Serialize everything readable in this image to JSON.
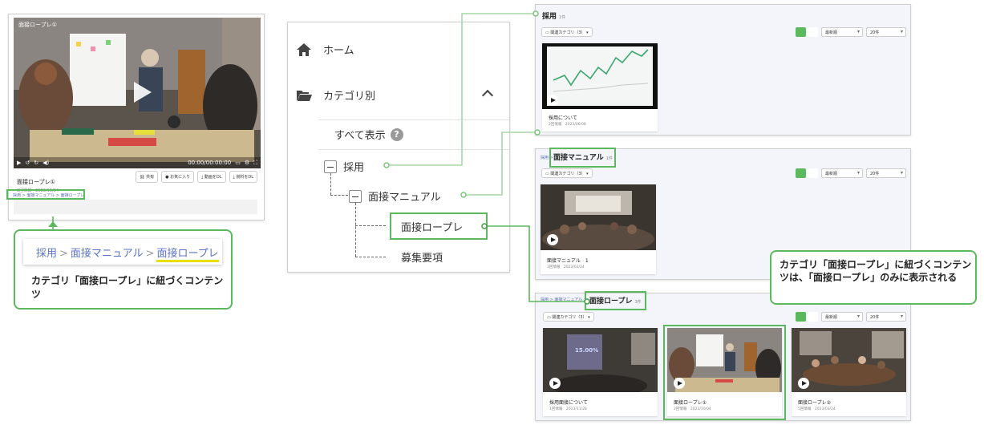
{
  "player": {
    "video_title": "面接ロープレ①",
    "time": "00:00/00:00:00",
    "title": "面接ロープレ①",
    "meta": "2回情報　2023/10/04",
    "buttons": [
      "共有",
      "お気に入り",
      "動画をDL",
      "資料をDL"
    ],
    "breadcrumb": "採用 > 面接マニュアル > 面接ロープレ"
  },
  "callout_left": {
    "crumb": [
      "採用",
      "面接マニュアル",
      "面接ロープレ"
    ],
    "separator": ">",
    "text": "カテゴリ「面接ロープレ」に紐づくコンテンツ"
  },
  "sidebar": {
    "home": "ホーム",
    "by_category": "カテゴリ別",
    "show_all": "すべて表示",
    "help": "?",
    "tree": {
      "level1": "採用",
      "level2": "面接マニュアル",
      "level3a": "面接ロープレ",
      "level3b": "募集要項"
    }
  },
  "panels": {
    "filter_label": "関連カテゴリ（3）",
    "sort": "最新順",
    "per_page": "20件",
    "saiyo": {
      "title": "採用",
      "count": "1件",
      "cards": [
        {
          "title": "採用について",
          "meta": "2回情報　2023/06/08"
        }
      ]
    },
    "mensetsu": {
      "crumb": "採用 >",
      "title": "面接マニュアル",
      "count": "1件",
      "cards": [
        {
          "title": "面接マニュアル　1",
          "meta": "3回情報　2023/03/24"
        }
      ]
    },
    "roleplay": {
      "crumb": "採用 > 面接マニュアル >",
      "title": "面接ロープレ",
      "count": "3件",
      "cards": [
        {
          "title": "採用面接について",
          "meta": "1回情報　2023/11/28",
          "stat": "15.00%"
        },
        {
          "title": "面接ロープレ①",
          "meta": "2回情報　2023/10/04"
        },
        {
          "title": "面接ロープレ②",
          "meta": "5回情報　2023/03/24"
        }
      ]
    }
  },
  "callout_right": {
    "text": "カテゴリ「面接ロープレ」に紐づくコンテンツは、「面接ロープレ」のみに表示される"
  },
  "colors": {
    "highlight": "#5cb85c",
    "link": "#5a73c4",
    "underline": "#e8e000",
    "view_active": "#5cb85c"
  }
}
